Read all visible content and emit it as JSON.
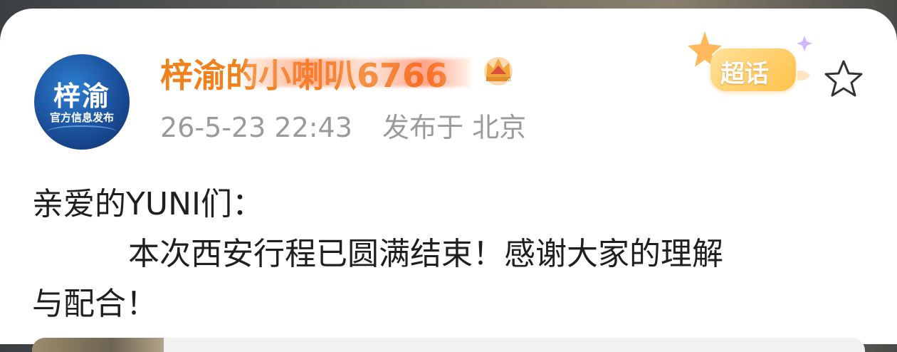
{
  "post": {
    "avatar": {
      "title": "梓渝",
      "subtitle": "官方信息发布"
    },
    "username": "梓渝的小喇叭6766",
    "timestamp": "26-5-23 22:43",
    "location": "发布于 北京",
    "badges": {
      "level_icon": "crown-badge-icon",
      "topic_badge": "超话"
    },
    "actions": {
      "favorite_icon": "star-outline-icon"
    },
    "content": {
      "line1": "亲爱的YUNI们：",
      "line2": "本次西安行程已圆满结束！感谢大家的理解",
      "line3": "与配合！"
    }
  },
  "colors": {
    "username": "#f0811d",
    "meta": "#9a9a9a",
    "text": "#1f1f1f",
    "topic_badge": "#ffc24a"
  }
}
